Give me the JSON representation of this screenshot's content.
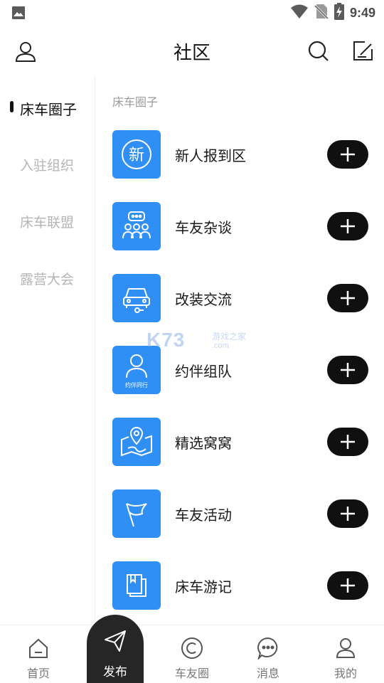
{
  "status_bar": {
    "time": "9:49",
    "icons": [
      "image-icon",
      "wifi-icon",
      "no-sim-icon",
      "battery-charging-icon"
    ]
  },
  "header": {
    "title": "社区",
    "left_icon": "profile-icon",
    "right_icons": [
      "search-icon",
      "edit-icon"
    ]
  },
  "sidebar": {
    "items": [
      {
        "label": "床车圈子",
        "active": true
      },
      {
        "label": "入驻组织",
        "active": false
      },
      {
        "label": "床车联盟",
        "active": false
      },
      {
        "label": "露营大会",
        "active": false
      }
    ]
  },
  "main": {
    "section_label": "床车圈子",
    "rows": [
      {
        "name": "新人报到区",
        "icon": "new-badge-icon",
        "icon_text": "新"
      },
      {
        "name": "车友杂谈",
        "icon": "chat-group-icon"
      },
      {
        "name": "改装交流",
        "icon": "car-wrench-icon"
      },
      {
        "name": "约伴组队",
        "icon": "companion-icon",
        "icon_text": "约伴同行"
      },
      {
        "name": "精选窝窝",
        "icon": "map-pin-icon"
      },
      {
        "name": "车友活动",
        "icon": "flag-icon"
      },
      {
        "name": "床车游记",
        "icon": "book-icon"
      }
    ],
    "add_icon": "plus-icon"
  },
  "watermark": {
    "brand": "K73",
    "sub": "游戏之家",
    "domain": ".com"
  },
  "bottom_nav": {
    "items": [
      {
        "label": "首页",
        "icon": "home-icon"
      },
      {
        "label": "发布",
        "icon": "send-icon"
      },
      {
        "label": "车友圈",
        "icon": "circle-icon"
      },
      {
        "label": "消息",
        "icon": "message-icon"
      },
      {
        "label": "我的",
        "icon": "user-icon"
      }
    ]
  },
  "colors": {
    "accent_blue": "#2f8ff5",
    "dark": "#101010",
    "muted": "#b5b5b5"
  }
}
